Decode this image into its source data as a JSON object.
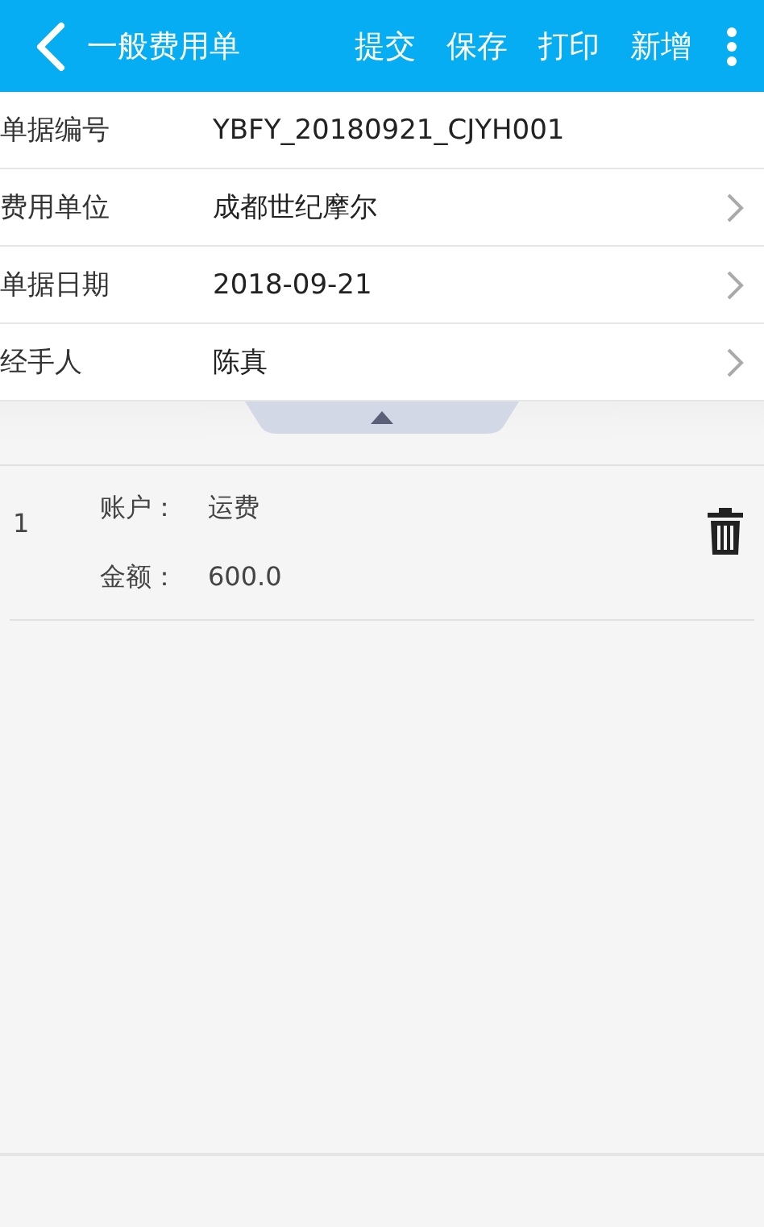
{
  "header": {
    "title": "一般费用单",
    "actions": [
      "提交",
      "保存",
      "打印",
      "新增"
    ]
  },
  "fields": [
    {
      "label": "单据编号",
      "value": "YBFY_20180921_CJYH001",
      "navigable": false
    },
    {
      "label": "费用单位",
      "value": "成都世纪摩尔",
      "navigable": true
    },
    {
      "label": "单据日期",
      "value": "2018-09-21",
      "navigable": true
    },
    {
      "label": "经手人",
      "value": "陈真",
      "navigable": true
    }
  ],
  "entries": [
    {
      "index": "1",
      "lines": [
        {
          "label": "账户：",
          "value": "运费"
        },
        {
          "label": "金额：",
          "value": "600.0"
        }
      ]
    }
  ]
}
